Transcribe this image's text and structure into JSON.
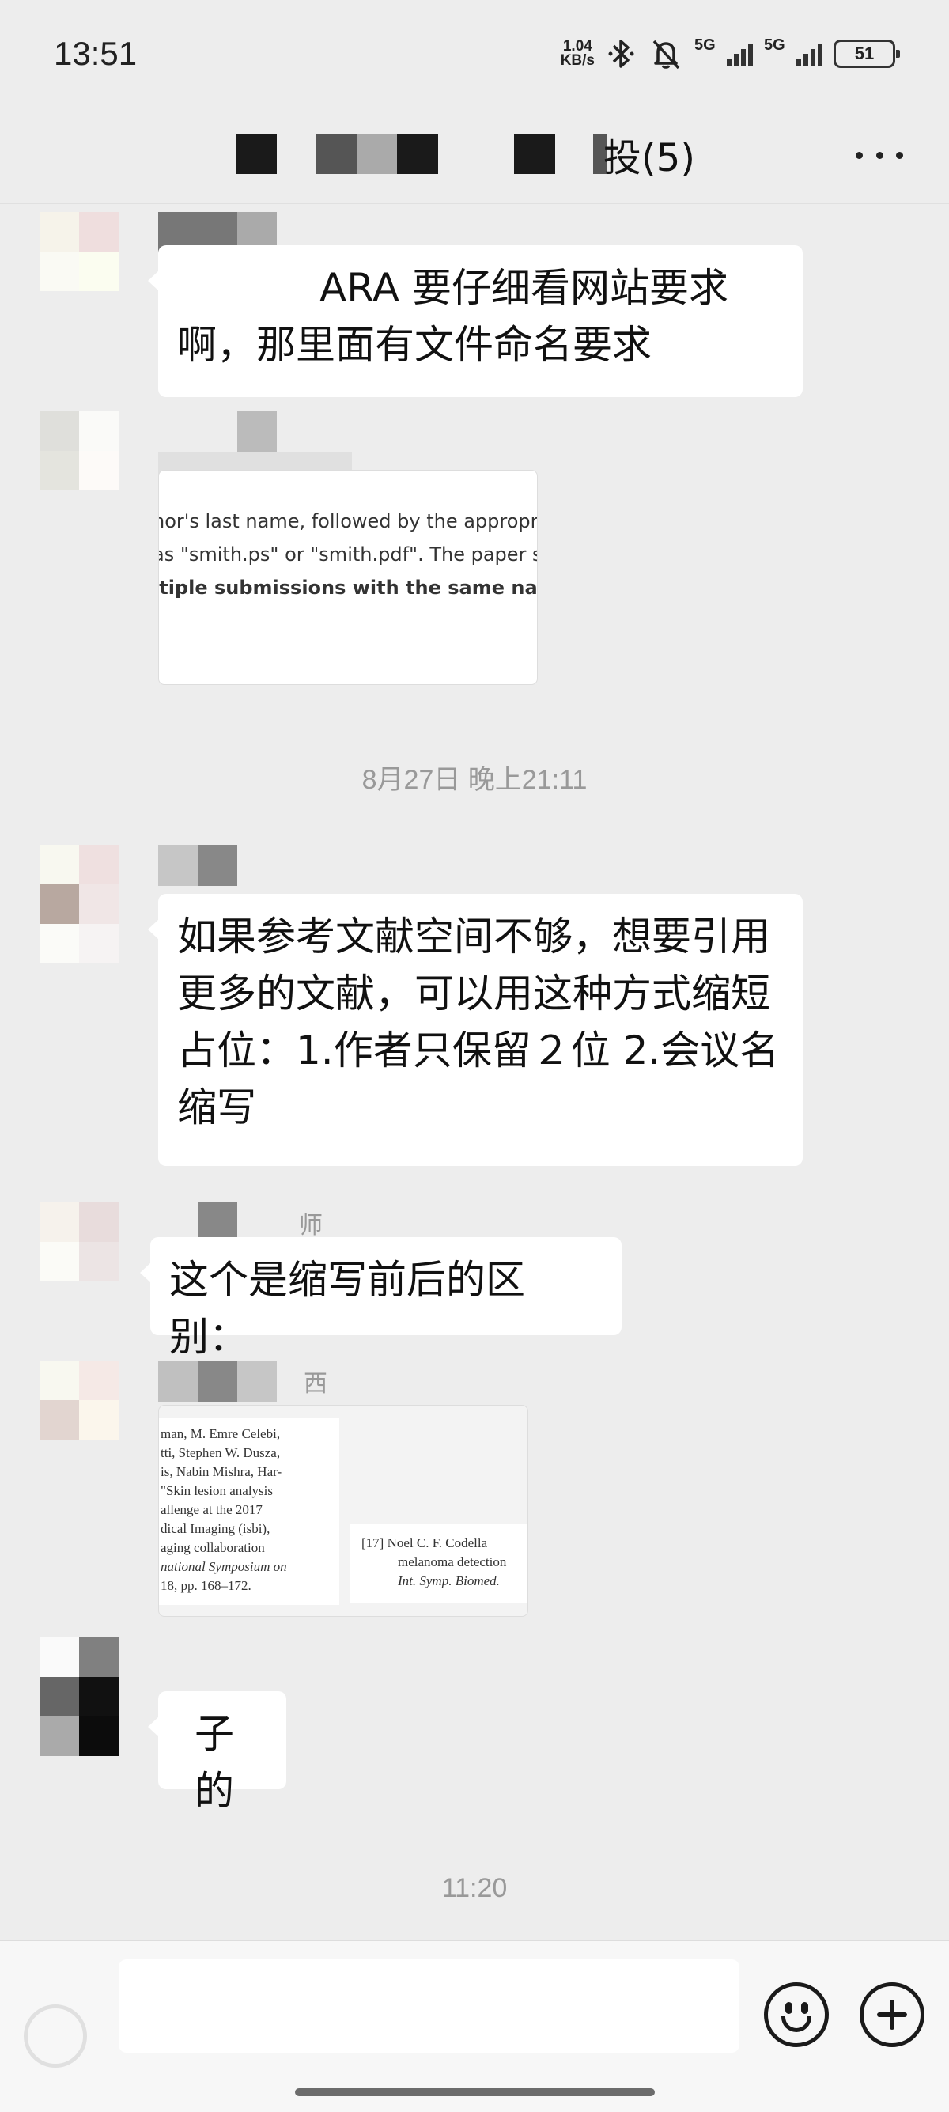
{
  "status_bar": {
    "time": "13:51",
    "net_speed_value": "1.04",
    "net_speed_unit": "KB/s",
    "sim1": "5G",
    "sim2": "5G",
    "battery": "51"
  },
  "header": {
    "title_visible_text": "投(5)",
    "more_icon": "more-dots-icon"
  },
  "messages": [
    {
      "type": "text",
      "sender_visible_suffix": "",
      "text_line_1": "ARA 要仔细看网站要求",
      "text_line_2": "啊，那里面有文件命名要求"
    },
    {
      "type": "image",
      "sender_visible_suffix": "",
      "image_lines": [
        "hor's last name, followed by the appropr",
        "as \"smith.ps\" or \"smith.pdf\". The paper s",
        "ltiple submissions with the same name"
      ]
    },
    {
      "type": "timestamp",
      "text": "8月27日 晚上21:11"
    },
    {
      "type": "text",
      "sender_visible_suffix": "",
      "text_lines": [
        "如果参考文献空间不够，想要引用",
        "更多的文献，可以用这种方式缩短",
        "占位：1.作者只保留２位  2.会议名",
        "缩写"
      ]
    },
    {
      "type": "text",
      "sender_visible_suffix": "师",
      "text_lines": [
        "这个是缩写前后的区别："
      ]
    },
    {
      "type": "image",
      "sender_visible_suffix": "西",
      "left_lines": [
        "man, M. Emre Celebi,",
        "tti, Stephen W. Dusza,",
        "is, Nabin Mishra, Har-",
        "\"Skin lesion analysis",
        "allenge at the 2017",
        "dical Imaging (isbi),",
        "aging collaboration",
        "national Symposium on",
        "18, pp. 168–172."
      ],
      "right_lines": [
        "[17] Noel C. F. Codella",
        "melanoma detection",
        "Int. Symp. Biomed."
      ]
    },
    {
      "type": "text",
      "sender_visible_suffix": "",
      "text_lines": [
        "子的"
      ]
    },
    {
      "type": "timestamp",
      "text": "11:20"
    }
  ],
  "input_bar": {
    "voice_icon": "voice-icon",
    "emoji_icon": "emoji-icon",
    "plus_icon": "plus-icon"
  },
  "colors": {
    "background": "#ededed",
    "bubble": "#ffffff",
    "timestamp_text": "#999999"
  }
}
